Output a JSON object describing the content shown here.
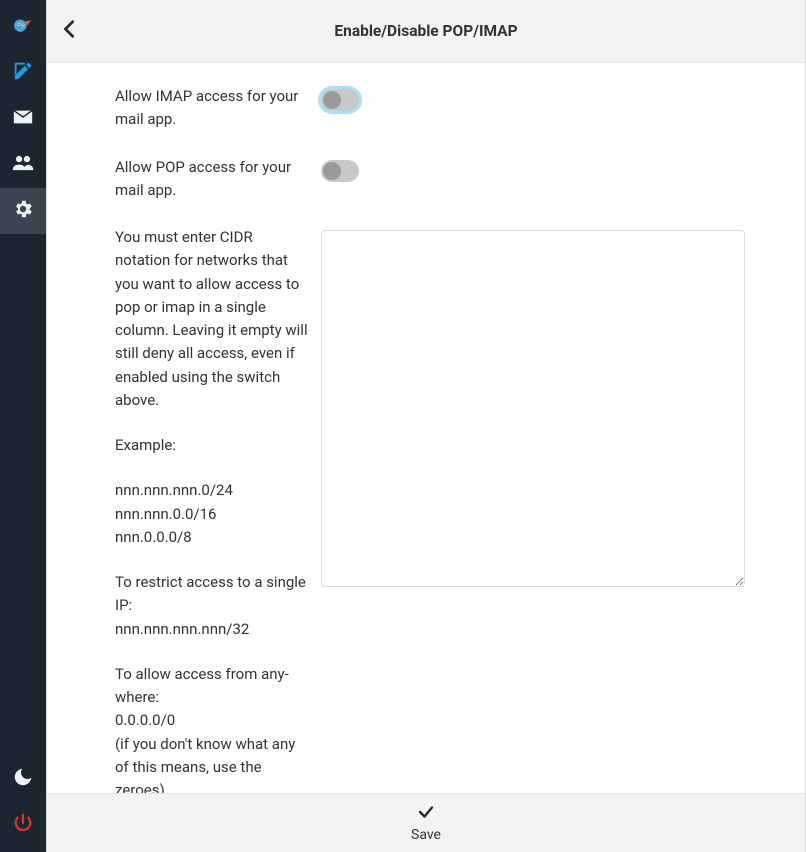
{
  "header": {
    "title": "Enable/Disable POP/IMAP"
  },
  "sidebar": {
    "items": [
      {
        "name": "brand-icon"
      },
      {
        "name": "compose-icon"
      },
      {
        "name": "mail-icon"
      },
      {
        "name": "users-icon"
      },
      {
        "name": "gear-icon"
      },
      {
        "name": "moon-icon"
      },
      {
        "name": "power-icon"
      }
    ]
  },
  "settings": {
    "imap_label": "Allow IMAP access for your mail app.",
    "imap_enabled": false,
    "pop_label": "Allow POP access for your mail app.",
    "pop_enabled": false,
    "cidr_value": "",
    "cidr_help": {
      "intro": "You must enter CIDR notation for networks that you want to allow access to pop or imap in a single column. Leaving it empty will still deny all ac­cess, even if enabled using the switch above.",
      "example_label": "Example:",
      "examples": "nnn.nnn.nnn.0/24\nnnn.nnn.0.0/16\nnnn.0.0.0/8",
      "single_ip": "To restrict access to a single IP:\nnnn.nnn.nnn.nnn/32",
      "anywhere": "To allow access from any­where:\n0.0.0.0/0\n(if you don't know what any of this means, use the zeroes)"
    }
  },
  "footer": {
    "save_label": "Save"
  }
}
